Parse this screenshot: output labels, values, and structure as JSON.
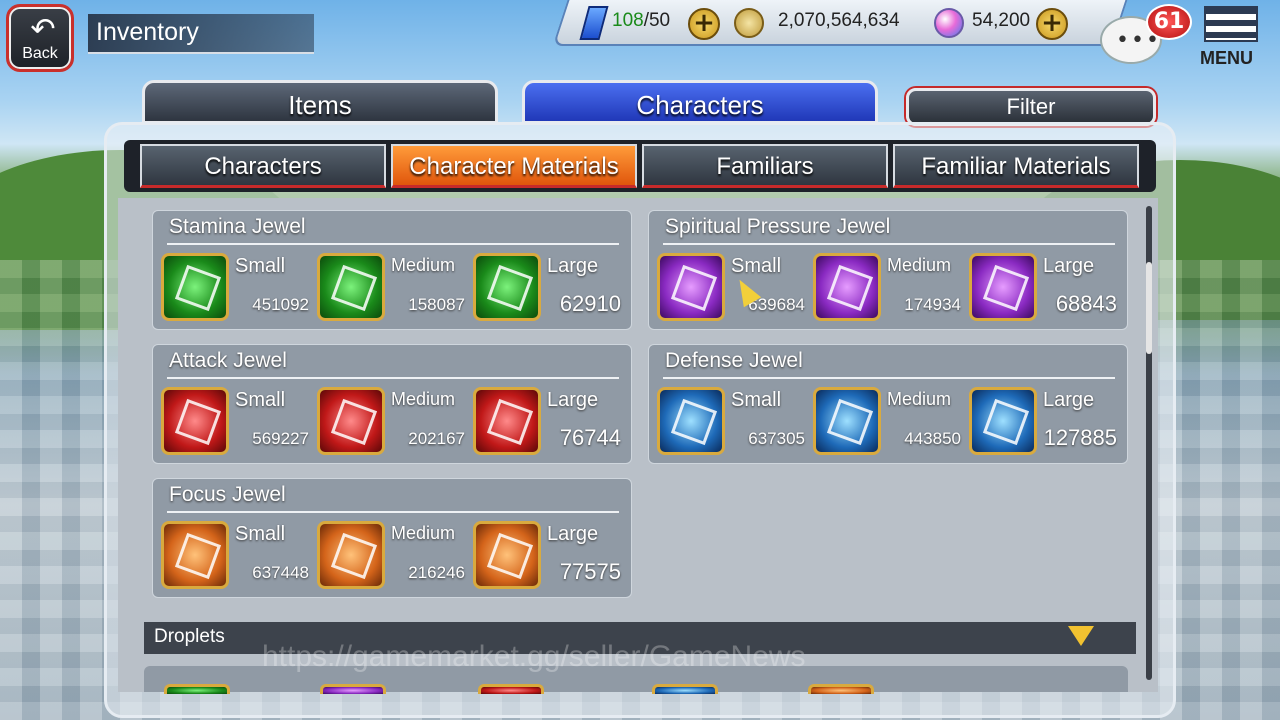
{
  "header": {
    "back_label": "Back",
    "title": "Inventory"
  },
  "resources": {
    "stamina_current": "108",
    "stamina_max": "/50",
    "coins": "2,070,564,634",
    "orbs": "54,200"
  },
  "notifications": {
    "count": "61"
  },
  "menu": {
    "label": "MENU"
  },
  "tabs": {
    "items": "Items",
    "characters": "Characters",
    "filter": "Filter"
  },
  "subtabs": [
    "Characters",
    "Character Materials",
    "Familiars",
    "Familiar Materials"
  ],
  "jewels": [
    {
      "title": "Stamina Jewel",
      "color": "green",
      "items": [
        {
          "size": "Small",
          "count": "451092"
        },
        {
          "size": "Medium",
          "count": "158087"
        },
        {
          "size": "Large",
          "count": "62910"
        }
      ]
    },
    {
      "title": "Spiritual Pressure Jewel",
      "color": "purple",
      "items": [
        {
          "size": "Small",
          "count": "639684"
        },
        {
          "size": "Medium",
          "count": "174934"
        },
        {
          "size": "Large",
          "count": "68843"
        }
      ]
    },
    {
      "title": "Attack Jewel",
      "color": "red",
      "items": [
        {
          "size": "Small",
          "count": "569227"
        },
        {
          "size": "Medium",
          "count": "202167"
        },
        {
          "size": "Large",
          "count": "76744"
        }
      ]
    },
    {
      "title": "Defense Jewel",
      "color": "blue",
      "items": [
        {
          "size": "Small",
          "count": "637305"
        },
        {
          "size": "Medium",
          "count": "443850"
        },
        {
          "size": "Large",
          "count": "127885"
        }
      ]
    },
    {
      "title": "Focus Jewel",
      "color": "orange",
      "items": [
        {
          "size": "Small",
          "count": "637448"
        },
        {
          "size": "Medium",
          "count": "216246"
        },
        {
          "size": "Large",
          "count": "77575"
        }
      ]
    }
  ],
  "droplets": {
    "title": "Droplets"
  },
  "watermark": "https://gamemarket.gg/seller/GameNews"
}
